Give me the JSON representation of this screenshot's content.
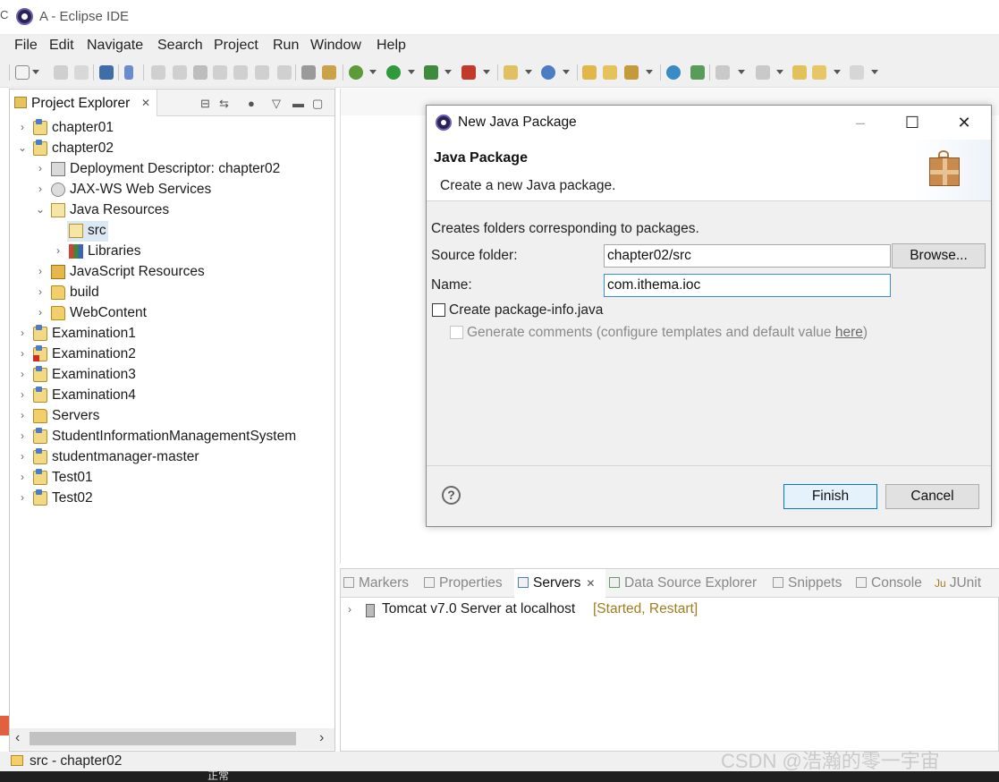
{
  "window": {
    "title": "A - Eclipse IDE",
    "edge_char": "C"
  },
  "menu": [
    "File",
    "Edit",
    "Navigate",
    "Search",
    "Project",
    "Run",
    "Window",
    "Help"
  ],
  "explorer": {
    "title": "Project Explorer",
    "tree": [
      {
        "label": "chapter01",
        "expanded": false,
        "icon": "project-icon"
      },
      {
        "label": "chapter02",
        "expanded": true,
        "icon": "project-icon"
      },
      {
        "label": "Deployment Descriptor: chapter02",
        "expanded": false,
        "icon": "deployment-descriptor-icon"
      },
      {
        "label": "JAX-WS Web Services",
        "expanded": false,
        "icon": "web-services-icon"
      },
      {
        "label": "Java Resources",
        "expanded": true,
        "icon": "java-resources-icon"
      },
      {
        "label": "src",
        "expanded": null,
        "icon": "source-folder-icon",
        "selected": true
      },
      {
        "label": "Libraries",
        "expanded": false,
        "icon": "libraries-icon"
      },
      {
        "label": "JavaScript Resources",
        "expanded": false,
        "icon": "javascript-resources-icon"
      },
      {
        "label": "build",
        "expanded": false,
        "icon": "folder-icon"
      },
      {
        "label": "WebContent",
        "expanded": false,
        "icon": "folder-icon"
      },
      {
        "label": "Examination1",
        "expanded": false,
        "icon": "project-icon"
      },
      {
        "label": "Examination2",
        "expanded": false,
        "icon": "project-error-icon"
      },
      {
        "label": "Examination3",
        "expanded": false,
        "icon": "project-icon"
      },
      {
        "label": "Examination4",
        "expanded": false,
        "icon": "project-icon"
      },
      {
        "label": "Servers",
        "expanded": false,
        "icon": "servers-folder-icon"
      },
      {
        "label": "StudentInformationManagementSystem",
        "expanded": false,
        "icon": "project-icon"
      },
      {
        "label": "studentmanager-master",
        "expanded": false,
        "icon": "project-icon"
      },
      {
        "label": "Test01",
        "expanded": false,
        "icon": "project-icon"
      },
      {
        "label": "Test02",
        "expanded": false,
        "icon": "project-icon"
      }
    ]
  },
  "dialog": {
    "title": "New Java Package",
    "heading": "Java Package",
    "subheading": "Create a new Java package.",
    "description": "Creates folders corresponding to packages.",
    "source_folder_label": "Source folder:",
    "source_folder_value": "chapter02/src",
    "browse_label": "Browse...",
    "name_label": "Name:",
    "name_value": "com.ithema.ioc",
    "create_info_label": "Create package-info.java",
    "create_info_checked": false,
    "generate_comments_prefix": "Generate comments (configure templates and default value ",
    "generate_comments_link": "here",
    "generate_comments_suffix": ")",
    "generate_comments_enabled": false,
    "finish_label": "Finish",
    "cancel_label": "Cancel",
    "help_symbol": "?"
  },
  "bottom_panel": {
    "tabs": [
      {
        "label": "Markers",
        "active": false
      },
      {
        "label": "Properties",
        "active": false
      },
      {
        "label": "Servers",
        "active": true
      },
      {
        "label": "Data Source Explorer",
        "active": false
      },
      {
        "label": "Snippets",
        "active": false
      },
      {
        "label": "Console",
        "active": false
      },
      {
        "label": "JUnit",
        "active": false
      }
    ],
    "junit_prefix": "Ju",
    "server_name": "Tomcat v7.0 Server at localhost",
    "server_state": "[Started, Restart]"
  },
  "status": {
    "text": "src - chapter02"
  },
  "taskbar": {
    "text": "正常"
  },
  "watermark": "CSDN @浩瀚的零一宇宙",
  "colors": {
    "accent": "#0078d7",
    "selection": "#dde8f5",
    "server_state": "#a07d1c"
  }
}
